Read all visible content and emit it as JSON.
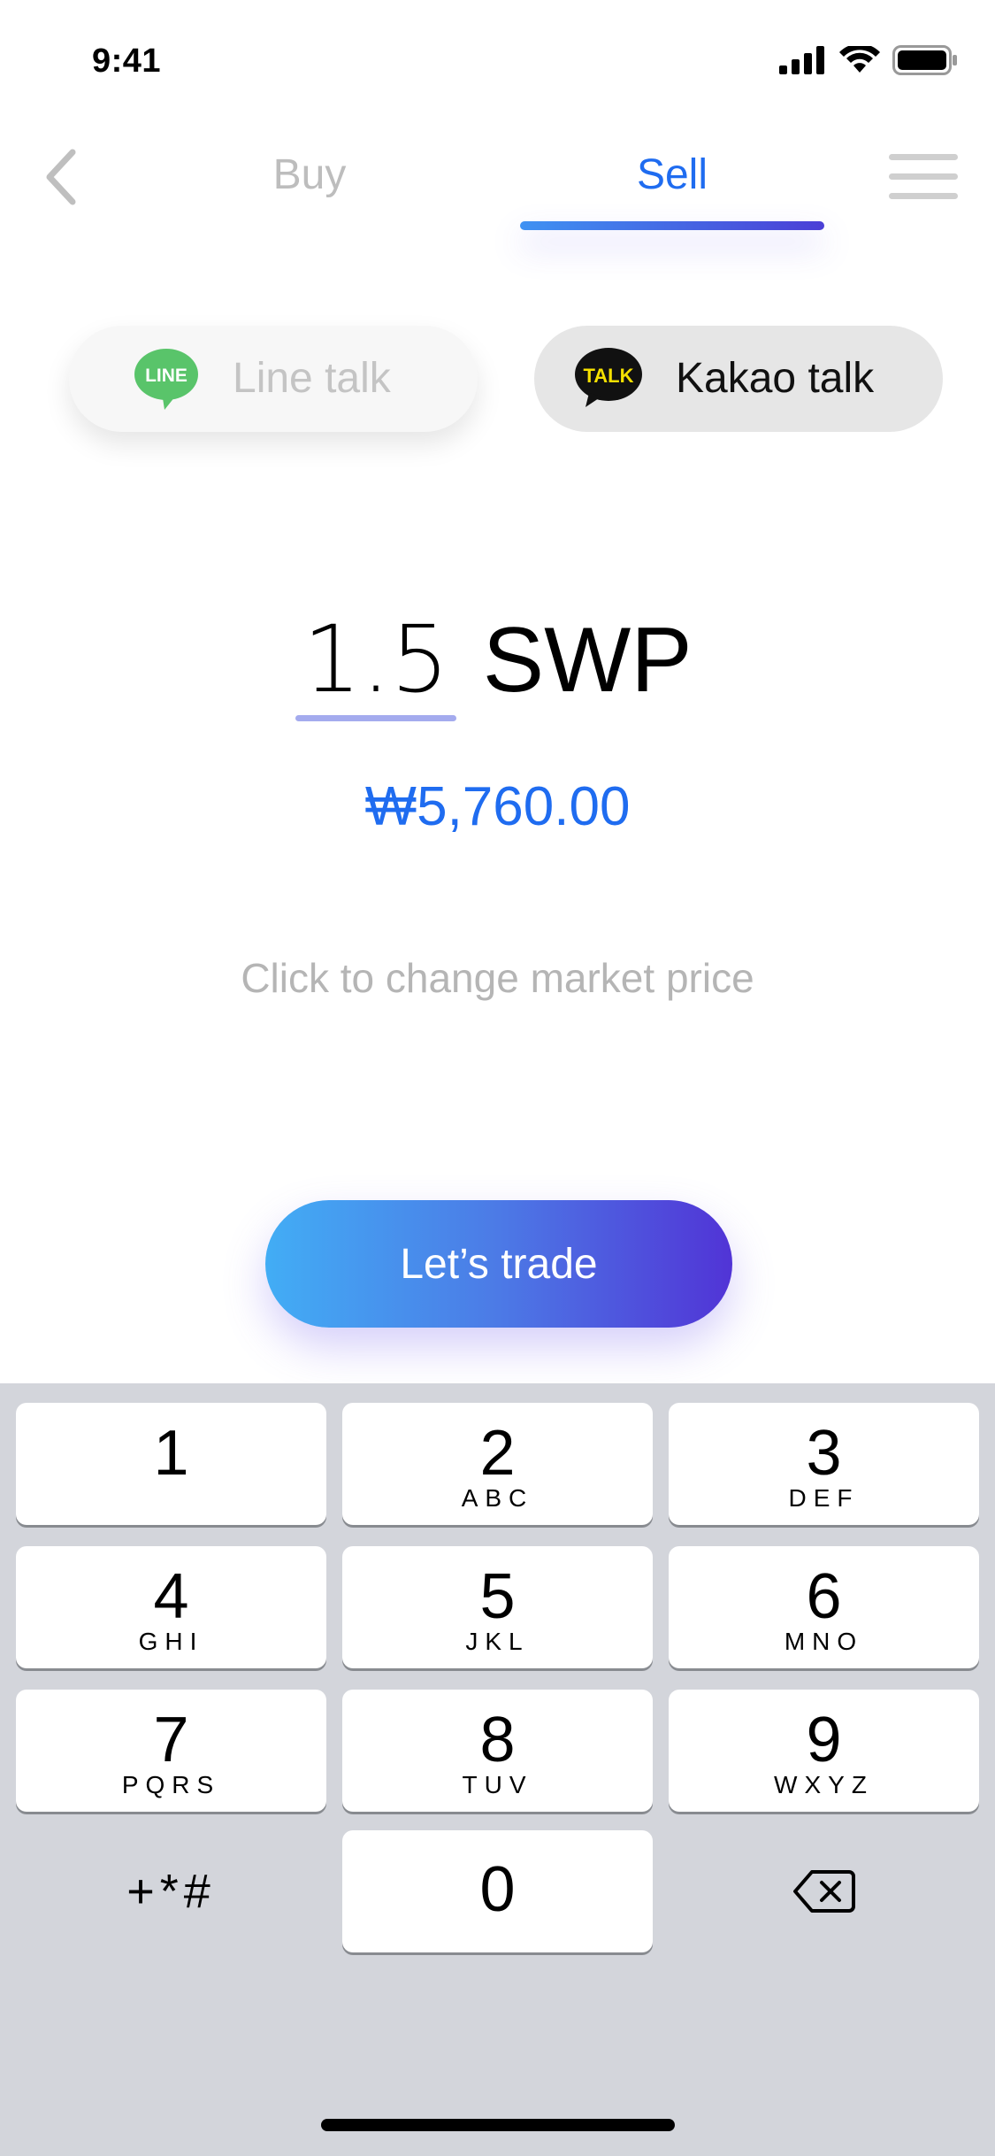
{
  "status_bar": {
    "time": "9:41"
  },
  "nav": {
    "tabs": [
      {
        "label": "Buy",
        "active": false
      },
      {
        "label": "Sell",
        "active": true
      }
    ],
    "active_color": "#1f6cf0",
    "inactive_color": "#bdbdbd"
  },
  "chat_options": [
    {
      "label": "Line talk",
      "icon": "line-icon",
      "icon_text": "LINE",
      "selected": false
    },
    {
      "label": "Kakao talk",
      "icon": "kakao-talk-icon",
      "icon_text": "TALK",
      "selected": true
    }
  ],
  "amount": {
    "value": "1.5",
    "unit": "SWP"
  },
  "fiat_value": "₩5,760.00",
  "hint": "Click to change market price",
  "cta": {
    "label": "Let’s trade"
  },
  "keypad": {
    "keys": [
      {
        "num": "1",
        "letters": ""
      },
      {
        "num": "2",
        "letters": "ABC"
      },
      {
        "num": "3",
        "letters": "DEF"
      },
      {
        "num": "4",
        "letters": "GHI"
      },
      {
        "num": "5",
        "letters": "JKL"
      },
      {
        "num": "6",
        "letters": "MNO"
      },
      {
        "num": "7",
        "letters": "PQRS"
      },
      {
        "num": "8",
        "letters": "TUV"
      },
      {
        "num": "9",
        "letters": "WXYZ"
      },
      {
        "num": "0",
        "letters": ""
      }
    ],
    "symbols_label": "+*#",
    "delete_icon": "backspace-icon"
  }
}
